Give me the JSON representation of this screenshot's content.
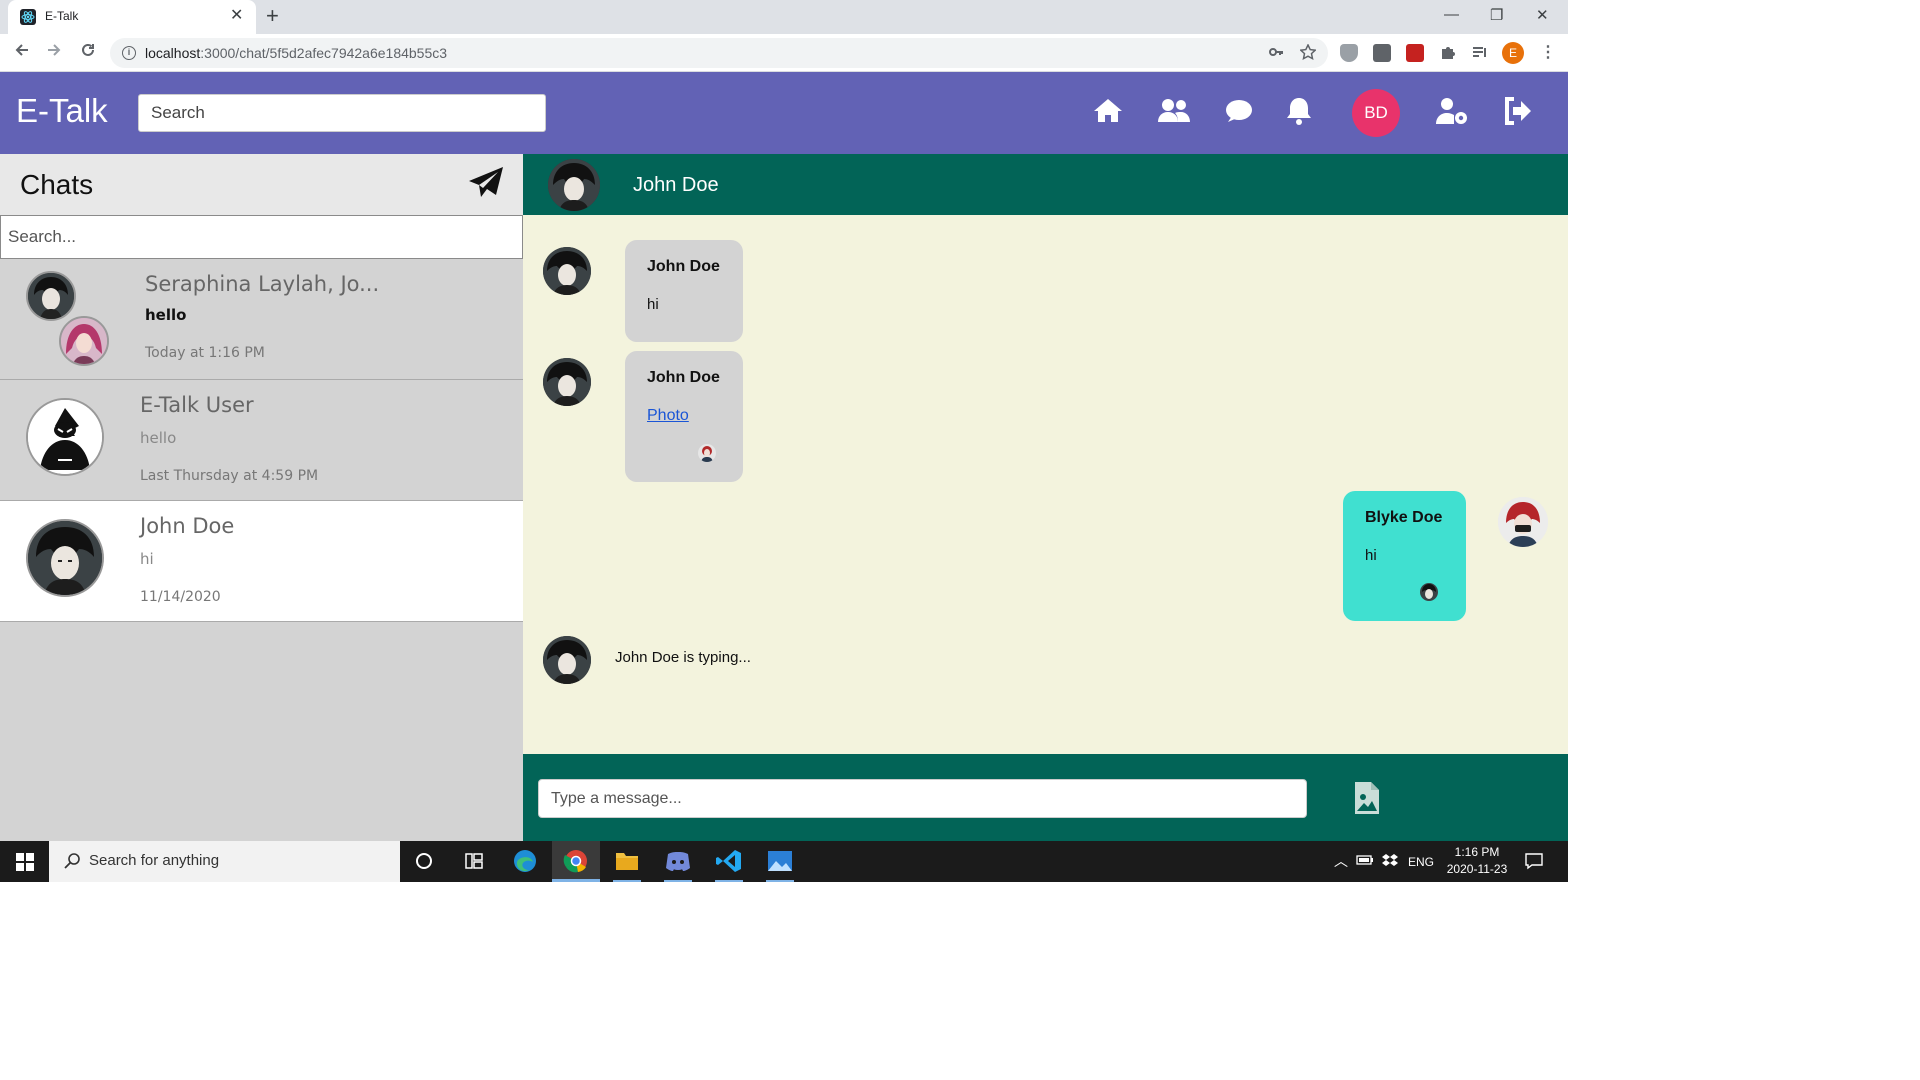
{
  "browser": {
    "tab_title": "E-Talk",
    "tab_close": "✕",
    "new_tab": "+",
    "url_host": "localhost",
    "url_rest": ":3000/chat/5f5d2afec7942a6e184b55c3",
    "profile_initial": "E",
    "window_minimize": "—",
    "window_restore": "❐",
    "window_close": "✕"
  },
  "app": {
    "brand": "E-Talk",
    "search_placeholder": "Search",
    "user_initials": "BD",
    "nav_icons": [
      "home-icon",
      "friends-icon",
      "chat-icon",
      "notifications-icon",
      "user-settings-icon",
      "logout-icon"
    ],
    "colors": {
      "appbar": "#6262b5",
      "chat_header": "#026457",
      "chat_bg": "#f3f3dd",
      "own_bubble": "#40e0d0",
      "avatar_bd": "#e8336b"
    }
  },
  "sidebar": {
    "title": "Chats",
    "search_placeholder": "Search...",
    "chats": [
      {
        "name": "Seraphina Laylah, Jo...",
        "preview": "hello",
        "time": "Today at 1:16 PM",
        "unread": true
      },
      {
        "name": "E-Talk User",
        "preview": "hello",
        "time": "Last Thursday at 4:59 PM",
        "unread": false
      },
      {
        "name": "John Doe",
        "preview": "hi",
        "time": "11/14/2020",
        "unread": false
      }
    ]
  },
  "conversation": {
    "title": "John Doe",
    "messages": [
      {
        "author": "John Doe",
        "text": "hi",
        "direction": "in"
      },
      {
        "author": "John Doe",
        "link": "Photo",
        "direction": "in"
      },
      {
        "author": "Blyke Doe",
        "text": "hi",
        "direction": "out"
      }
    ],
    "typing": "John Doe is typing...",
    "input_placeholder": "Type a message..."
  },
  "taskbar": {
    "search_placeholder": "Search for anything",
    "language": "ENG",
    "time": "1:16 PM",
    "date": "2020-11-23"
  }
}
